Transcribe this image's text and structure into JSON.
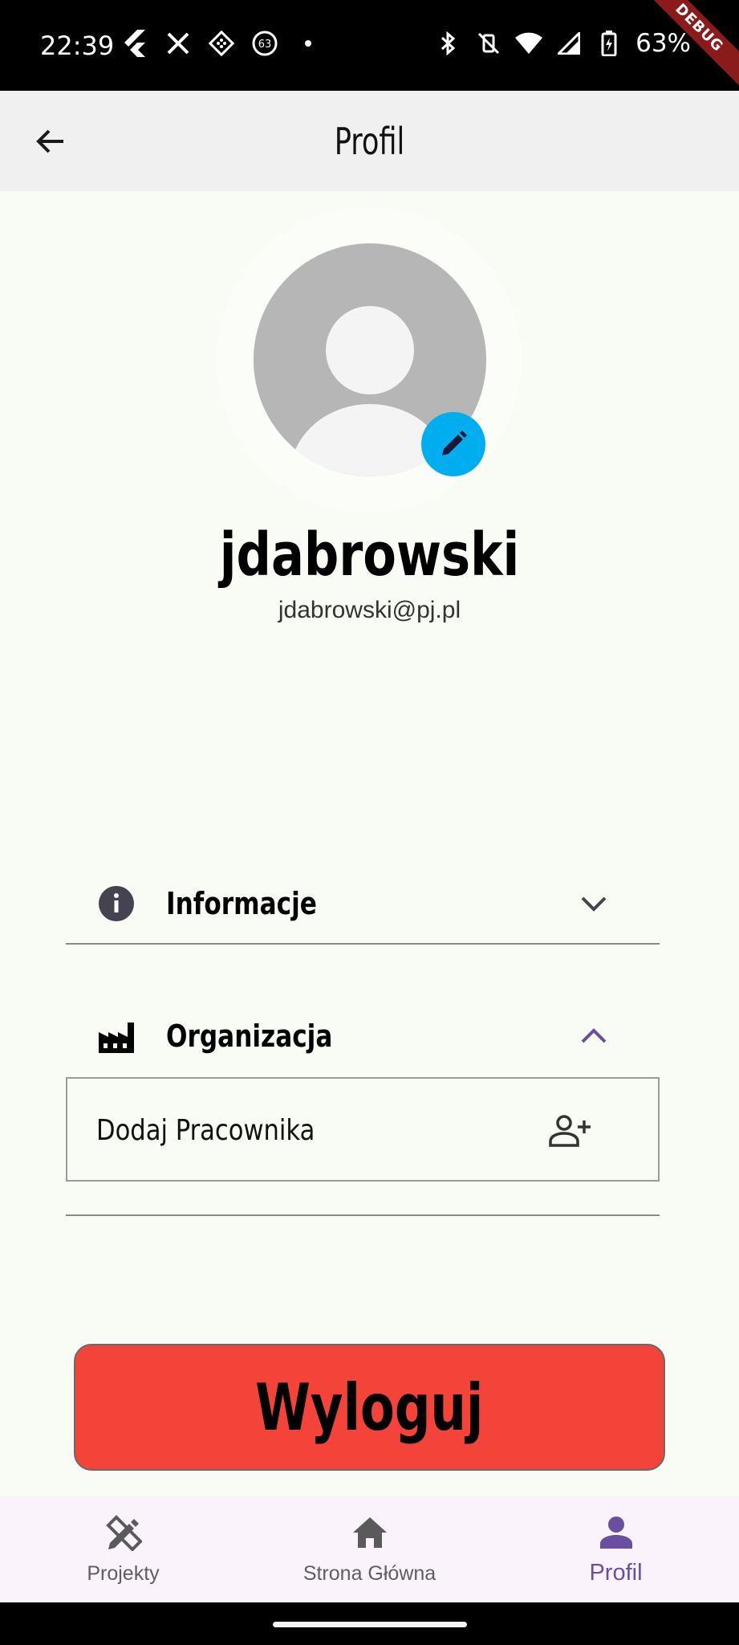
{
  "status_bar": {
    "time": "22:39",
    "notification_icons": [
      "flutter-icon",
      "x-icon",
      "grid-app-icon",
      "badge-63-icon",
      "dot-icon"
    ],
    "badge_number": "63",
    "right_icons": [
      "bluetooth-icon",
      "vibrate-off-icon",
      "wifi-icon",
      "signal-icon",
      "battery-charging-icon"
    ],
    "battery_percent": "63%",
    "debug_label": "DEBUG"
  },
  "app_bar": {
    "title": "Profil",
    "back_icon": "arrow-left-icon"
  },
  "profile": {
    "username": "jdabrowski",
    "email": "jdabrowski@pj.pl",
    "avatar_icon": "default-avatar-icon",
    "edit_icon": "pencil-icon",
    "edit_color": "#00aef0"
  },
  "sections": {
    "info": {
      "label": "Informacje",
      "icon": "info-icon",
      "expanded": false
    },
    "organization": {
      "label": "Organizacja",
      "icon": "factory-icon",
      "expanded": true
    }
  },
  "organization": {
    "add_employee_label": "Dodaj Pracownika",
    "add_employee_icon": "person-add-icon"
  },
  "logout": {
    "label": "Wyloguj",
    "color": "#f44338"
  },
  "bottom_nav": {
    "items": [
      {
        "label": "Projekty",
        "icon": "design-tools-icon",
        "active": false
      },
      {
        "label": "Strona Główna",
        "icon": "home-icon",
        "active": false
      },
      {
        "label": "Profil",
        "icon": "person-icon",
        "active": true
      }
    ],
    "active_color": "#6a4fa0"
  }
}
